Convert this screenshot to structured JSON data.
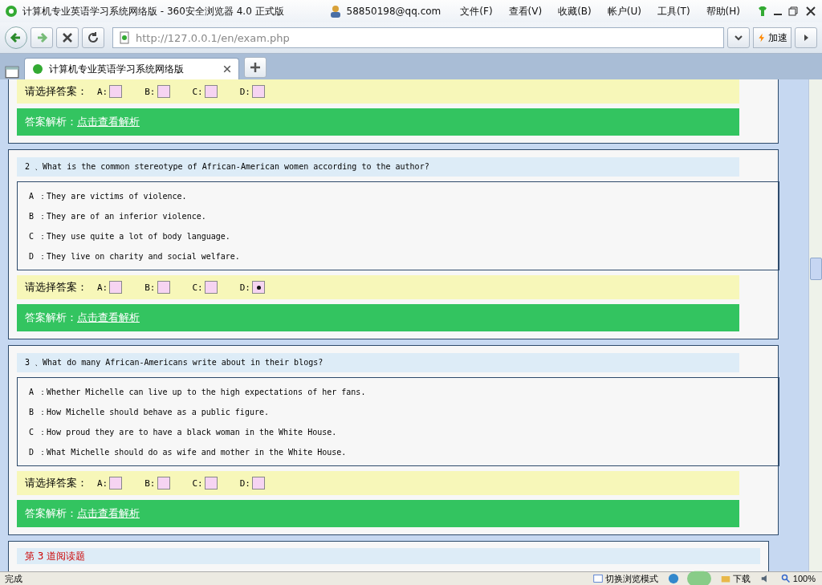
{
  "window": {
    "title": "计算机专业英语学习系统网络版 - 360安全浏览器 4.0 正式版",
    "user": "58850198@qq.com",
    "menu": [
      "文件(F)",
      "查看(V)",
      "收藏(B)",
      "帐户(U)",
      "工具(T)",
      "帮助(H)"
    ]
  },
  "toolbar": {
    "url": "http://127.0.0.1/en/exam.php",
    "speed_button": "加速"
  },
  "tabs": [
    {
      "title": "计算机专业英语学习系统网络版",
      "selected": true
    }
  ],
  "questions": [
    {
      "answer_label": "请选择答案：",
      "choices": [
        {
          "letter": "A:",
          "selected": false
        },
        {
          "letter": "B:",
          "selected": false
        },
        {
          "letter": "C:",
          "selected": false
        },
        {
          "letter": "D:",
          "selected": false
        }
      ],
      "analysis_label": "答案解析：",
      "analysis_link": "点击查看解析"
    },
    {
      "question": "2 、What is the common stereotype of African-American women according to the author?",
      "options": [
        {
          "letter": "A ：",
          "text": "They are victims of violence."
        },
        {
          "letter": "B ：",
          "text": "They are of an inferior violence."
        },
        {
          "letter": "C ：",
          "text": "They use quite a lot of body language."
        },
        {
          "letter": "D ：",
          "text": "They live on charity and social welfare."
        }
      ],
      "answer_label": "请选择答案：",
      "choices": [
        {
          "letter": "A:",
          "selected": false
        },
        {
          "letter": "B:",
          "selected": false
        },
        {
          "letter": "C:",
          "selected": false
        },
        {
          "letter": "D:",
          "selected": true
        }
      ],
      "analysis_label": "答案解析：",
      "analysis_link": "点击查看解析"
    },
    {
      "question": "3 、What do many African-Americans write about in their blogs?",
      "options": [
        {
          "letter": "A ：",
          "text": "Whether Michelle can live up to the high expectations of her fans."
        },
        {
          "letter": "B ：",
          "text": "How Michelle should behave as a public figure."
        },
        {
          "letter": "C ：",
          "text": "How proud they are to have a black woman in the White House."
        },
        {
          "letter": "D ：",
          "text": "What Michelle should do as wife and mother in the White House."
        }
      ],
      "answer_label": "请选择答案：",
      "choices": [
        {
          "letter": "A:",
          "selected": false
        },
        {
          "letter": "B:",
          "selected": false
        },
        {
          "letter": "C:",
          "selected": false
        },
        {
          "letter": "D:",
          "selected": false
        }
      ],
      "analysis_label": "答案解析：",
      "analysis_link": "点击查看解析"
    }
  ],
  "next_section": {
    "title": "第 3 道阅读题"
  },
  "status_bar": {
    "status": "完成",
    "mode_button": "切换浏览模式",
    "download_button": "下载",
    "zoom": "100%"
  }
}
